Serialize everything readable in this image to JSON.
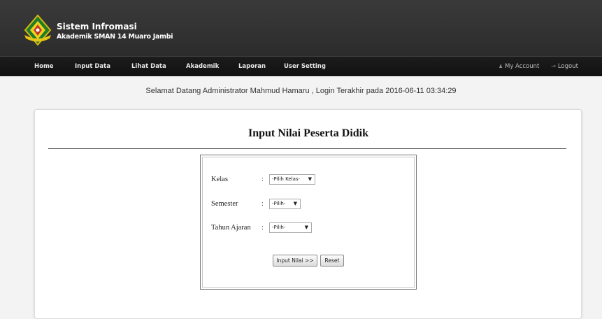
{
  "header": {
    "brand_title": "Sistem Infromasi",
    "brand_subtitle": "Akademik SMAN 14 Muaro Jambi"
  },
  "nav": {
    "home": "Home",
    "input_data": "Input Data",
    "lihat_data": "Lihat Data",
    "akademik": "Akademik",
    "laporan": "Laporan",
    "user_setting": "User Setting",
    "my_account": "My Account",
    "logout": "Logout"
  },
  "welcome": "Selamat Datang Administrator Mahmud Hamaru , Login Terakhir pada 2016-06-11 03:34:29",
  "form": {
    "title": "Input Nilai Peserta Didik",
    "colon": ":",
    "kelas": {
      "label": "Kelas",
      "value": "-Pilih Kelas-"
    },
    "semester": {
      "label": "Semester",
      "value": "-Pilih-"
    },
    "tahun_ajaran": {
      "label": "Tahun Ajaran",
      "value": "-Pilih-"
    },
    "submit_label": "Input Nilai >>",
    "reset_label": "Reset"
  },
  "colors": {
    "header_bg": "#333333",
    "navbar_bg": "#171717",
    "page_bg": "#f3f3f3"
  }
}
